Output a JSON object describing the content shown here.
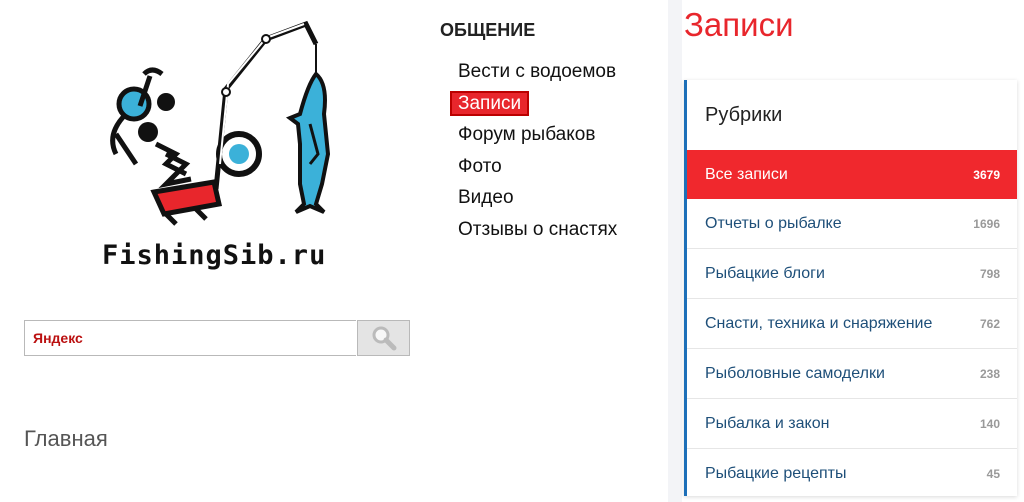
{
  "logo": {
    "text": "FishingSib.ru"
  },
  "search": {
    "placeholder": "Яндекс"
  },
  "home_link": "Главная",
  "nav": {
    "title": "ОБЩЕНИЕ",
    "items": [
      "Вести с водоемов",
      "Записи",
      "Форум рыбаков",
      "Фото",
      "Видео",
      "Отзывы о снастях"
    ],
    "active": "Записи"
  },
  "page_title": "Записи",
  "rubrics": {
    "title": "Рубрики",
    "items": [
      {
        "label": "Все записи",
        "count": "3679"
      },
      {
        "label": "Отчеты о рыбалке",
        "count": "1696"
      },
      {
        "label": "Рыбацкие блоги",
        "count": "798"
      },
      {
        "label": "Снасти, техника и снаряжение",
        "count": "762"
      },
      {
        "label": "Рыболовные самоделки",
        "count": "238"
      },
      {
        "label": "Рыбалка и закон",
        "count": "140"
      },
      {
        "label": "Рыбацкие рецепты",
        "count": "45"
      }
    ]
  },
  "colors": {
    "accent": "#e8262c",
    "panel_border": "#1d6fb8",
    "link": "#1e4f79",
    "logo_blue": "#3bb1d9"
  }
}
